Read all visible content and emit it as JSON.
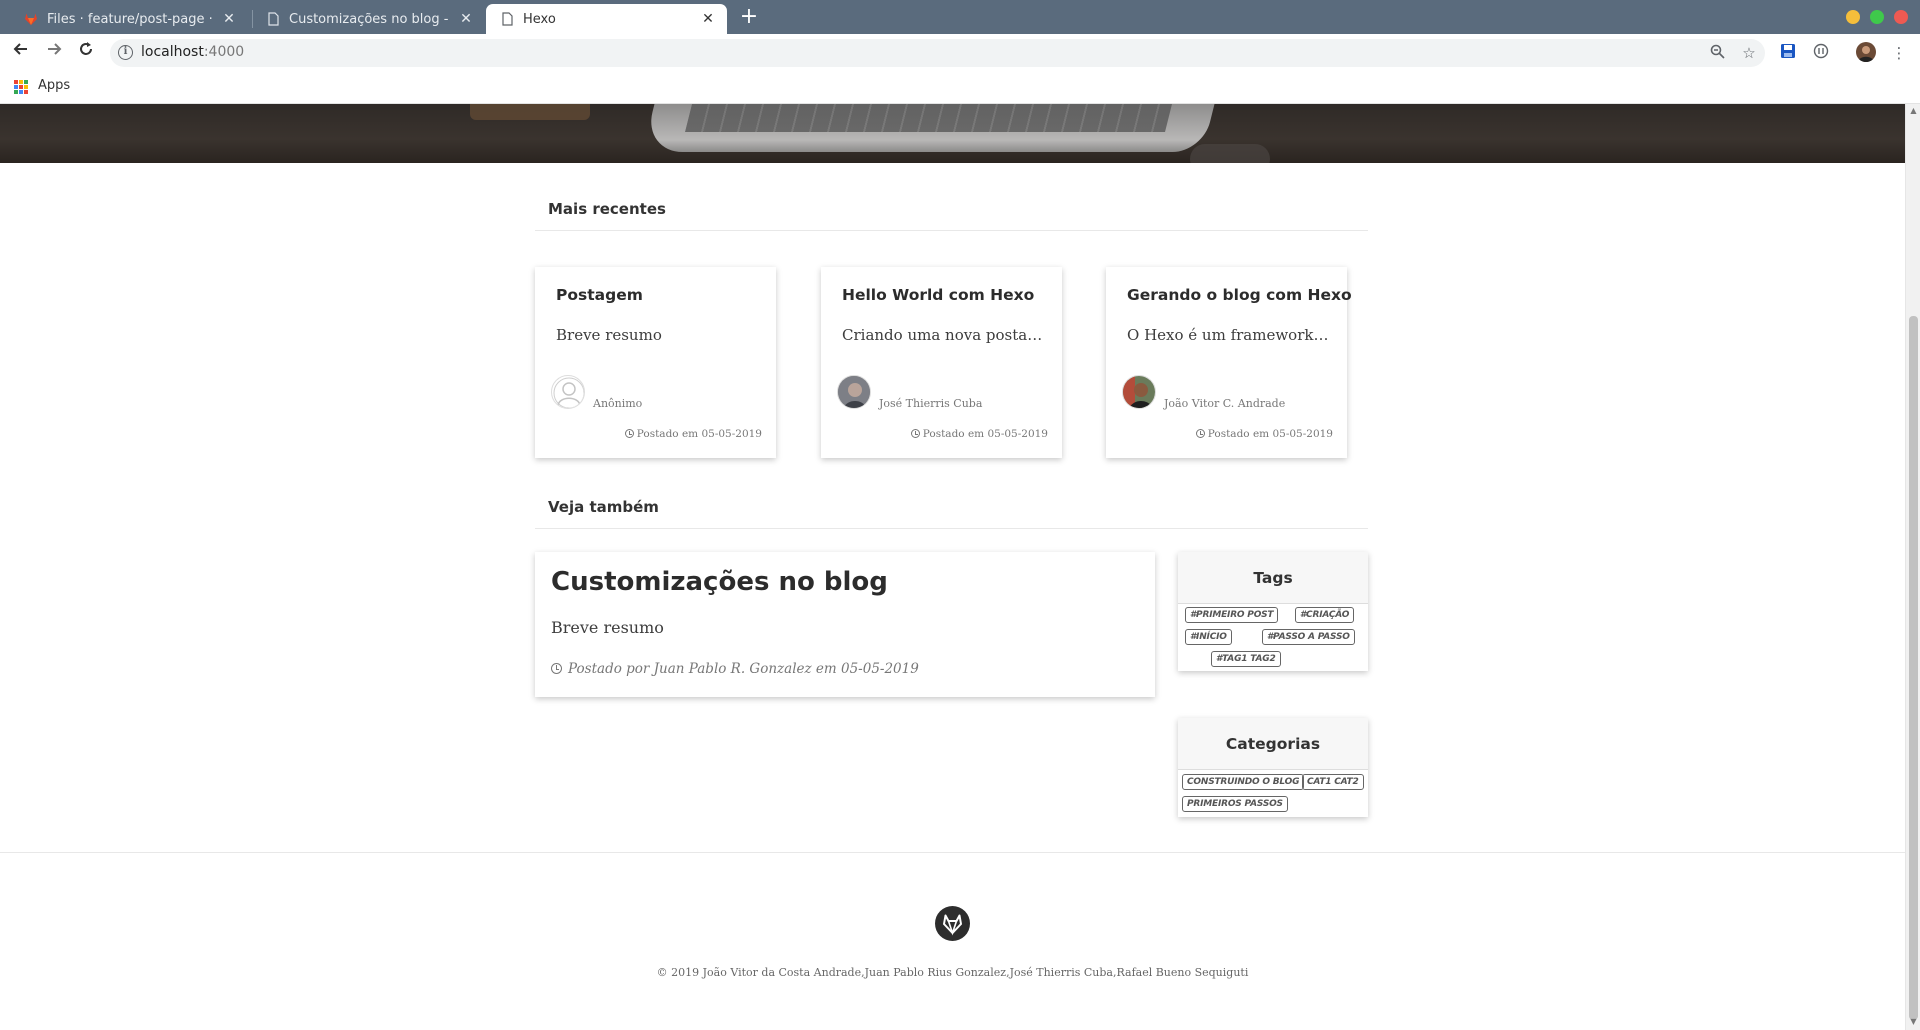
{
  "browser": {
    "tabs": [
      {
        "title": "Files · feature/post-page · Grupo 3",
        "icon": "gitlab-icon",
        "active": false
      },
      {
        "title": "Customizações no blog - Hexo",
        "icon": "page-icon",
        "active": false
      },
      {
        "title": "Hexo",
        "icon": "page-icon",
        "active": true
      }
    ],
    "url_host": "localhost",
    "url_port": ":4000",
    "bookmarks": {
      "apps_label": "Apps"
    }
  },
  "page": {
    "recent_heading": "Mais recentes",
    "recent_posts": [
      {
        "title": "Postagem",
        "excerpt": "Breve resumo",
        "author": "Anônimo",
        "date": "Postado em 05-05-2019",
        "avatar": "anonymous-avatar"
      },
      {
        "title": "Hello World com Hexo",
        "excerpt": "Criando uma nova postagem",
        "author": "José Thierris Cuba",
        "date": "Postado em 05-05-2019",
        "avatar": "author-photo"
      },
      {
        "title": "Gerando o blog com Hexo",
        "excerpt": "O Hexo é um framework de",
        "author": "João Vitor C. Andrade",
        "date": "Postado em 05-05-2019",
        "avatar": "author-photo"
      }
    ],
    "see_also_heading": "Veja também",
    "featured": {
      "title": "Customizações no blog",
      "excerpt": "Breve resumo",
      "meta": "Postado por Juan Pablo R. Gonzalez em 05-05-2019"
    },
    "tags_widget": {
      "title": "Tags",
      "items": [
        "#PRIMEIRO POST",
        "#CRIAÇÃO",
        "#INÍCIO",
        "#PASSO A PASSO",
        "#TAG1 TAG2"
      ]
    },
    "categories_widget": {
      "title": "Categorias",
      "items": [
        "CONSTRUINDO O BLOG",
        "CAT1 CAT2",
        "PRIMEIROS PASSOS"
      ]
    },
    "footer": {
      "copyright": "© 2019 João Vitor da Costa Andrade,Juan Pablo Rius Gonzalez,José Thierris Cuba,Rafael Bueno Sequiguti"
    }
  },
  "colors": {
    "tabbar": "#5a6b7d",
    "window_close": "#ee5a52",
    "window_min": "#f5be3b",
    "window_max": "#3fc94b"
  }
}
